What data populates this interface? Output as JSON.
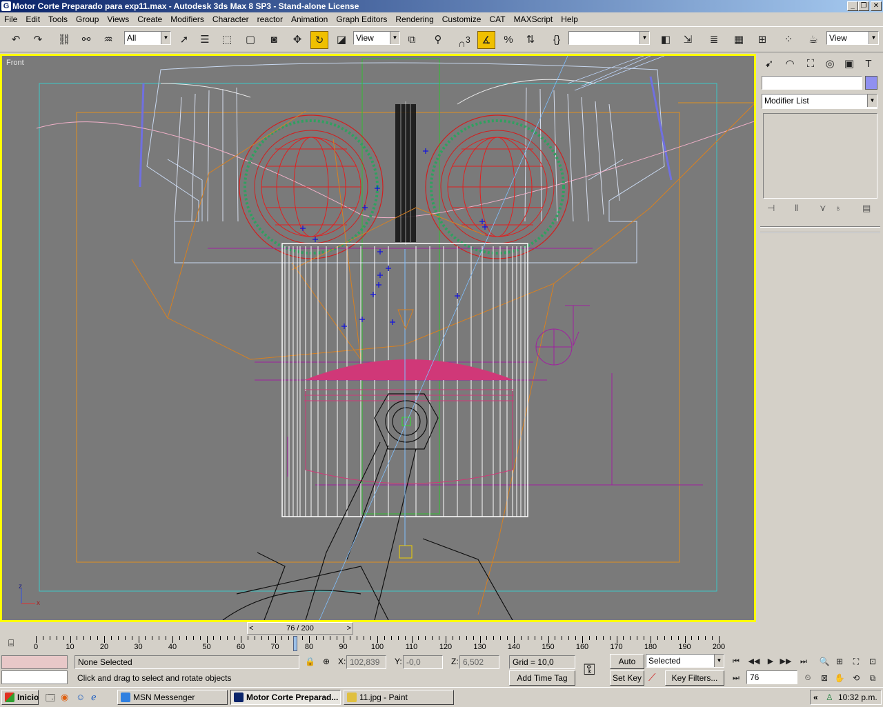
{
  "window": {
    "title": "Motor Corte Preparado para exp11.max - Autodesk 3ds Max 8 SP3  - Stand-alone License"
  },
  "menu": [
    "File",
    "Edit",
    "Tools",
    "Group",
    "Views",
    "Create",
    "Modifiers",
    "Character",
    "reactor",
    "Animation",
    "Graph Editors",
    "Rendering",
    "Customize",
    "CAT",
    "MAXScript",
    "Help"
  ],
  "toolbar": {
    "selection_filter": "All",
    "ref_coord": "View",
    "named_sel": "",
    "render_view": "View",
    "snap_label": "3"
  },
  "viewport": {
    "label": "Front",
    "axis_z": "z",
    "axis_x": "x"
  },
  "command_panel": {
    "name_field": "",
    "modifier_list": "Modifier List"
  },
  "timeline": {
    "frame_display": "76 / 200",
    "tick_labels": [
      "0",
      "10",
      "20",
      "30",
      "40",
      "50",
      "60",
      "70",
      "80",
      "90",
      "100",
      "110",
      "120",
      "130",
      "140",
      "150",
      "160",
      "170",
      "180",
      "190",
      "200"
    ],
    "current_frame": 76
  },
  "status": {
    "selection": "None Selected",
    "prompt": "Click and drag to select and rotate objects",
    "x_label": "X:",
    "x_value": "102,839",
    "y_label": "Y:",
    "y_value": "-0,0",
    "z_label": "Z:",
    "z_value": "6,502",
    "grid": "Grid = 10,0",
    "add_time_tag": "Add Time Tag",
    "auto_key": "Auto Key",
    "set_key": "Set Key",
    "selected": "Selected",
    "key_filters": "Key Filters...",
    "frame_field": "76"
  },
  "taskbar": {
    "start": "Inicio",
    "tasks": [
      "MSN Messenger",
      "Motor Corte Preparad...",
      "11.jpg - Paint"
    ],
    "clock": "10:32 p.m."
  },
  "colors": {
    "viewport_bg": "#7a7a7a",
    "active_border": "#ffff00",
    "title_blue": "#0a246a"
  }
}
